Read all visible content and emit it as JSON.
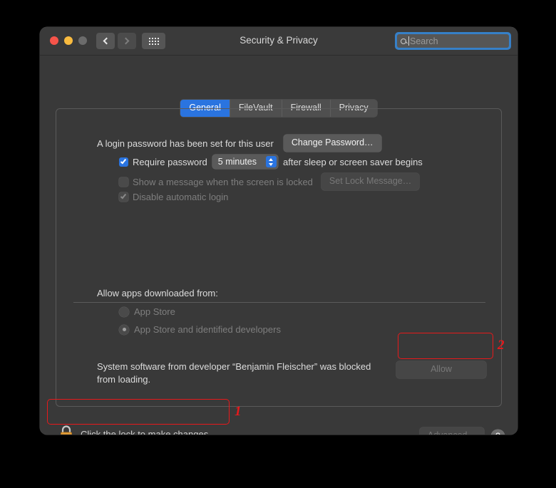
{
  "window": {
    "title": "Security & Privacy",
    "traffic_lights": [
      "close-red",
      "minimize-yellow",
      "zoom-disabled-grey"
    ],
    "nav": {
      "back_icon": "chevron-left-icon",
      "forward_icon": "chevron-right-icon",
      "grid_icon": "show-all-grid-icon"
    }
  },
  "search": {
    "placeholder": "Search",
    "icon": "search-icon",
    "focused": true
  },
  "tabs": [
    {
      "label": "General",
      "active": true
    },
    {
      "label": "FileVault",
      "active": false
    },
    {
      "label": "Firewall",
      "active": false
    },
    {
      "label": "Privacy",
      "active": false
    }
  ],
  "login": {
    "password_set_text": "A login password has been set for this user",
    "change_password_button": "Change Password…",
    "require_password_label": "Require password",
    "require_password_checked": true,
    "delay_value": "5 minutes",
    "after_text": "after sleep or screen saver begins",
    "show_message_label": "Show a message when the screen is locked",
    "show_message_checked": false,
    "set_lock_message_button": "Set Lock Message…",
    "disable_auto_login_label": "Disable automatic login",
    "disable_auto_login_checked": true
  },
  "gatekeeper": {
    "heading": "Allow apps downloaded from:",
    "options": [
      {
        "label": "App Store",
        "selected": false
      },
      {
        "label": "App Store and identified developers",
        "selected": true
      }
    ]
  },
  "blocked": {
    "message_line1": "System software from developer “Benjamin Fleischer” was blocked",
    "message_line2": "from loading.",
    "allow_button": "Allow",
    "allow_enabled": false
  },
  "footer": {
    "lock_icon": "closed-padlock-icon",
    "lock_text": "Click the lock to make changes.",
    "advanced_button": "Advanced…",
    "help_button": "?"
  },
  "annotations": [
    {
      "number": "1",
      "target": "lock-row"
    },
    {
      "number": "2",
      "target": "allow-button"
    }
  ],
  "colors": {
    "accent_blue": "#2a74e0",
    "annotation_red": "#e8191b",
    "window_bg": "#393939",
    "toolbar_bg": "#3a3a3a",
    "lock_body": "#e8a33d"
  }
}
